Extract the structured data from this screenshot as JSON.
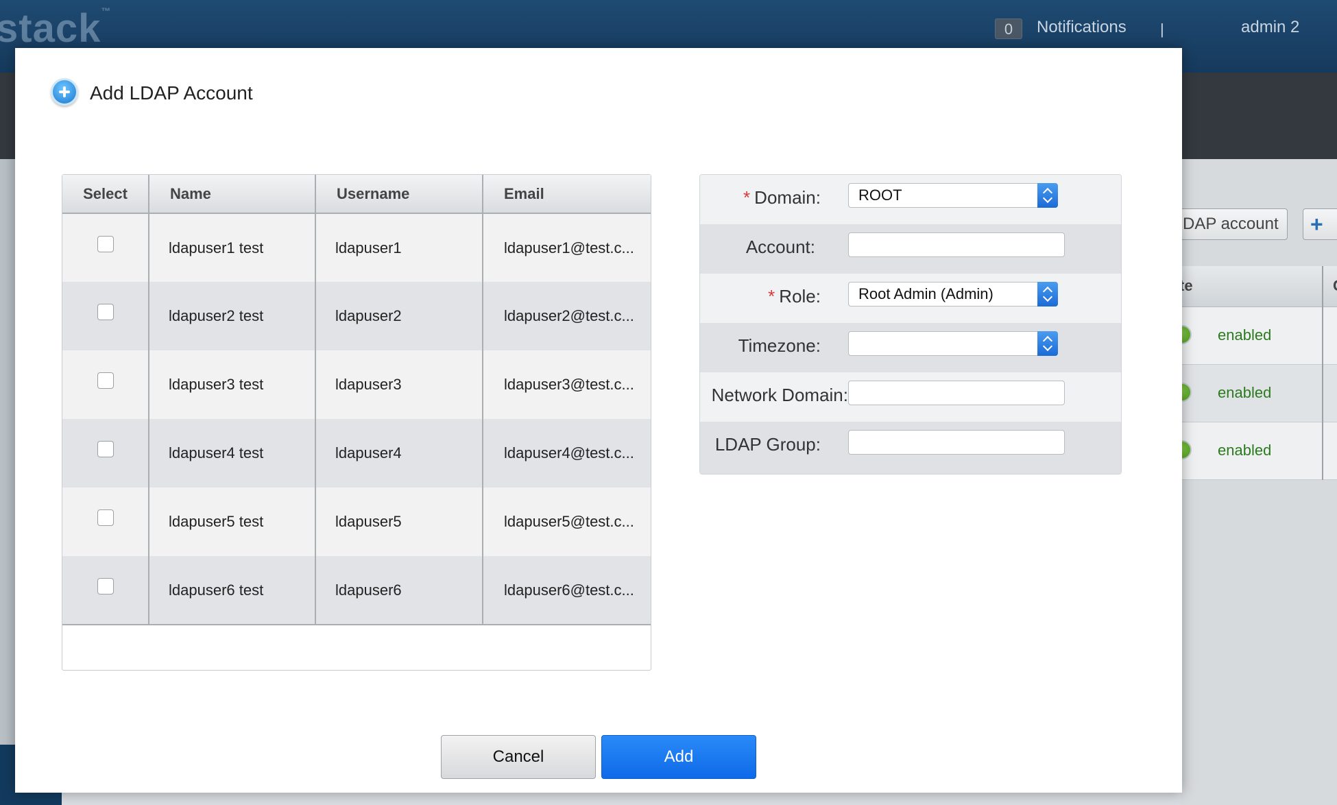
{
  "app": {
    "logo_text": "stack",
    "logo_tm": "™",
    "notifications_count": "0",
    "notifications_label": "Notifications",
    "separator": "|",
    "user": "admin 2"
  },
  "background": {
    "ldap_button_label": "DAP account",
    "add_button_symbol": "+",
    "table_header_state": "te",
    "table_header_next": "C",
    "rows": [
      {
        "state": "enabled"
      },
      {
        "state": "enabled"
      },
      {
        "state": "enabled"
      }
    ]
  },
  "dialog": {
    "title": "Add LDAP Account",
    "table": {
      "headers": [
        "Select",
        "Name",
        "Username",
        "Email"
      ],
      "rows": [
        {
          "name": "ldapuser1 test",
          "username": "ldapuser1",
          "email": "ldapuser1@test.c..."
        },
        {
          "name": "ldapuser2 test",
          "username": "ldapuser2",
          "email": "ldapuser2@test.c..."
        },
        {
          "name": "ldapuser3 test",
          "username": "ldapuser3",
          "email": "ldapuser3@test.c..."
        },
        {
          "name": "ldapuser4 test",
          "username": "ldapuser4",
          "email": "ldapuser4@test.c..."
        },
        {
          "name": "ldapuser5 test",
          "username": "ldapuser5",
          "email": "ldapuser5@test.c..."
        },
        {
          "name": "ldapuser6 test",
          "username": "ldapuser6",
          "email": "ldapuser6@test.c..."
        }
      ]
    },
    "form": {
      "required_mark": "*",
      "domain_label": "Domain:",
      "domain_value": "ROOT",
      "account_label": "Account:",
      "account_value": "",
      "role_label": "Role:",
      "role_value": "Root Admin (Admin)",
      "timezone_label": "Timezone:",
      "timezone_value": "",
      "network_domain_label": "Network Domain:",
      "network_domain_value": "",
      "ldap_group_label": "LDAP Group:",
      "ldap_group_value": ""
    },
    "buttons": {
      "cancel": "Cancel",
      "add": "Add"
    }
  },
  "colors": {
    "topbar": "#1f4a72",
    "primary_button": "#0e6ae8",
    "required": "#d43b3b",
    "enabled_text": "#2c7a1e"
  }
}
